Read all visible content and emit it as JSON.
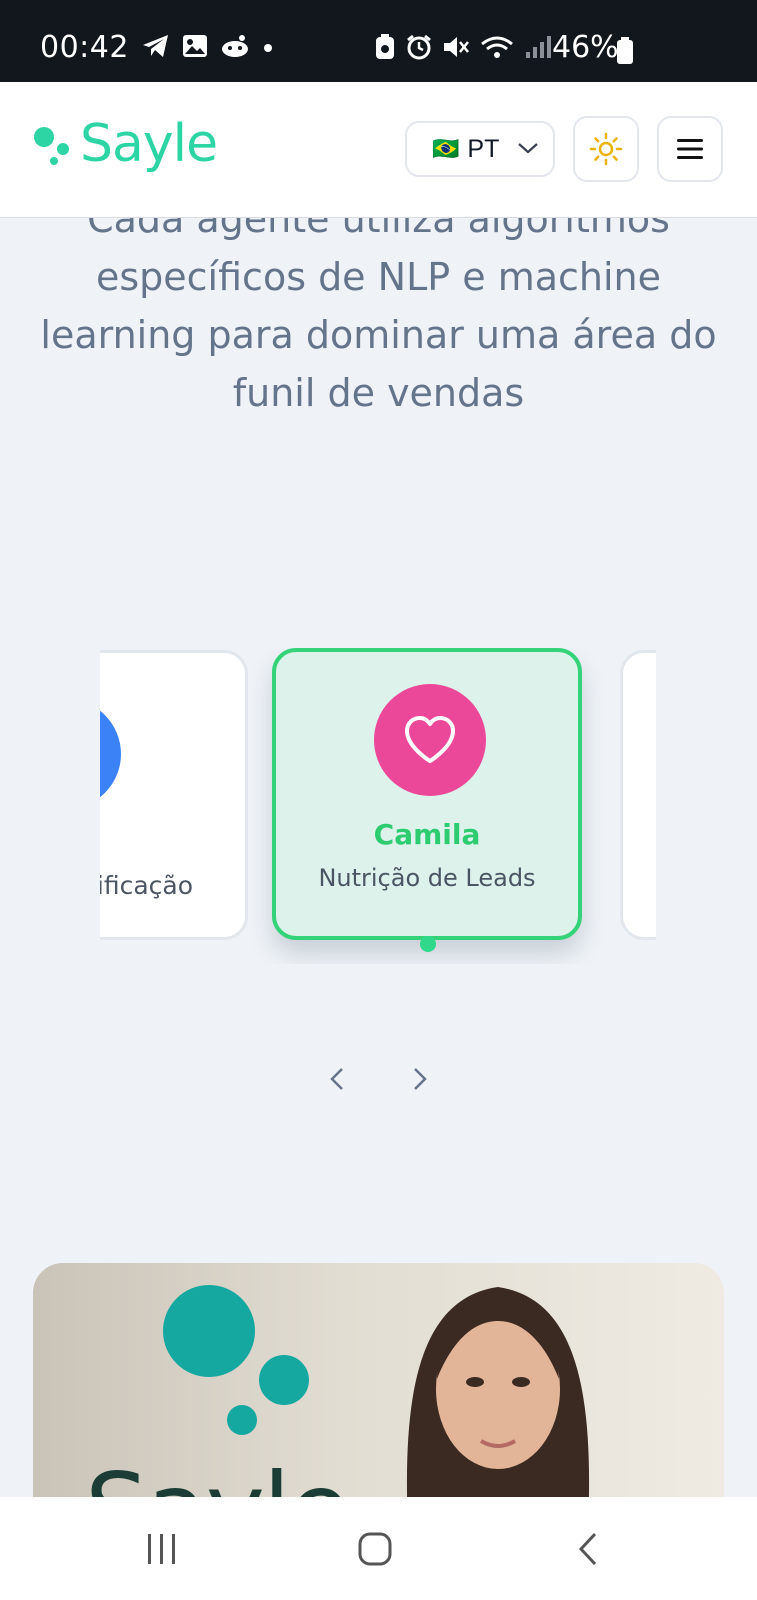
{
  "status_bar": {
    "time": "00:42",
    "battery_percent": "46%",
    "icons": [
      "telegram-icon",
      "gallery-icon",
      "reddit-icon",
      "dot-icon",
      "battery-saver-icon",
      "alarm-icon",
      "mute-icon",
      "wifi-icon",
      "signal-icon",
      "battery-icon"
    ]
  },
  "header": {
    "logo_text": "Sayle",
    "language": {
      "flag": "🇧🇷",
      "code": "PT"
    },
    "theme_toggle_icon": "sun-icon",
    "menu_icon": "hamburger-icon"
  },
  "section": {
    "description": "Cada agente utiliza algoritmos específicos de NLP e machine learning para dominar uma área do funil de vendas"
  },
  "carousel": {
    "previous_card": {
      "role": "Qualificação",
      "visible_role_fragment": "ificação",
      "avatar_color": "#3b82f6"
    },
    "active_card": {
      "name": "Camila",
      "role": "Nutrição de Leads",
      "icon": "heart-icon",
      "avatar_color": "#ec4899",
      "accent_color": "#2ecc71"
    },
    "indicator_active": true,
    "prev_icon": "chevron-left-icon",
    "next_icon": "chevron-right-icon"
  },
  "hero_image": {
    "alt": "Sayle"
  },
  "nav_bar": {
    "icons": [
      "recents-icon",
      "home-icon",
      "back-icon"
    ]
  },
  "colors": {
    "brand": "#2dd4a4",
    "page_bg": "#eff3f8",
    "text_muted": "#64748b"
  }
}
